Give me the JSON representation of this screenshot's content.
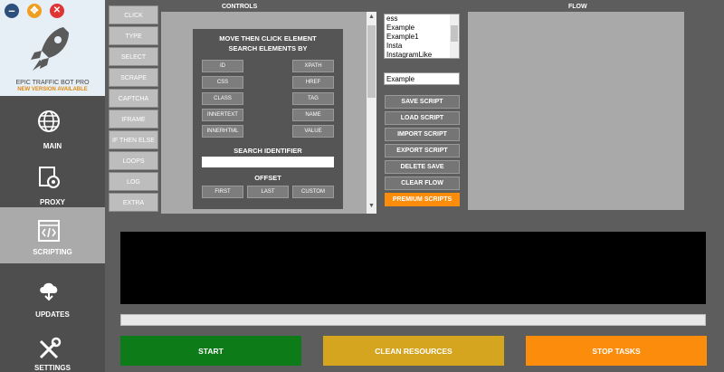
{
  "window": {
    "minimize_symbol": "–",
    "move_symbol": "✥",
    "close_symbol": "✕"
  },
  "brand": {
    "name": "EPIC TRAFFIC BOT PRO",
    "notice": "NEW VERSION AVAILABLE"
  },
  "nav": {
    "main": "MAIN",
    "proxy": "PROXY",
    "scripting": "SCRIPTING",
    "updates": "UPDATES",
    "settings": "SETTINGS"
  },
  "commands": [
    "CLICK",
    "TYPE",
    "SELECT",
    "SCRAPE",
    "CAPTCHA",
    "IFRAME",
    "IF THEN ELSE",
    "LOOPS",
    "LOG",
    "EXTRA"
  ],
  "controls_title": "CONTROLS",
  "flow_title": "FLOW",
  "element_panel": {
    "title1": "MOVE THEN CLICK ELEMENT",
    "title2": "SEARCH ELEMENTS BY",
    "left_buttons": [
      "ID",
      "CSS",
      "CLASS",
      "INNERTEXT",
      "INNERHTML"
    ],
    "right_buttons": [
      "XPATH",
      "HREF",
      "TAG",
      "NAME",
      "VALUE"
    ],
    "search_identifier_label": "SEARCH IDENTIFIER",
    "search_identifier_value": "",
    "offset_label": "OFFSET",
    "offset_buttons": [
      "FIRST",
      "LAST",
      "CUSTOM"
    ]
  },
  "scripts": {
    "list": [
      "ess",
      "Example",
      "Example1",
      "Insta",
      "InstagramLike"
    ],
    "name_value": "Example",
    "buttons": {
      "save": "SAVE SCRIPT",
      "load": "LOAD SCRIPT",
      "import": "IMPORT SCRIPT",
      "export": "EXPORT SCRIPT",
      "delete": "DELETE SAVE",
      "clear": "CLEAR FLOW",
      "premium": "PREMIUM SCRIPTS"
    }
  },
  "actions": {
    "start": "START",
    "clean": "CLEAN RESOURCES",
    "stop": "STOP TASKS"
  },
  "colors": {
    "start": "#0d7c18",
    "clean": "#d6a520",
    "stop": "#fb8c0c",
    "premium": "#fb8c0c",
    "selected_nav": "#aaaaaa"
  }
}
